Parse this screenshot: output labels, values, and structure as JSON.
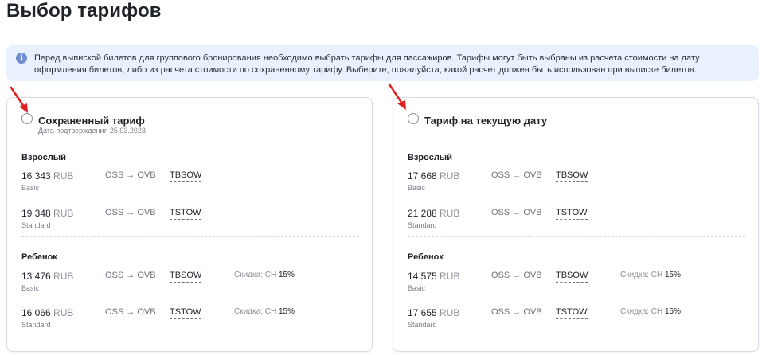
{
  "page": {
    "title": "Выбор тарифов"
  },
  "info": {
    "text": "Перед выпиской билетов для группового бронирования необходимо выбрать тарифы для пассажиров. Тарифы могут быть выбраны из расчета стоимости на дату оформления билетов, либо из расчета стоимости по сохраненному тарифу. Выберите, пожалуйста, какой расчет должен быть использован при выписке билетов.",
    "icon": "i"
  },
  "saved": {
    "title": "Сохраненный тариф",
    "subtitle": "Дата подтверждения 25.03.2023",
    "adult_label": "Взрослый",
    "child_label": "Ребенок",
    "rows": [
      {
        "amount": "16 343",
        "currency": "RUB",
        "class": "Basic",
        "route": "OSS → OVB",
        "code": "TBSOW",
        "discount_label": "",
        "discount_pct": ""
      },
      {
        "amount": "19 348",
        "currency": "RUB",
        "class": "Standard",
        "route": "OSS → OVB",
        "code": "TSTOW",
        "discount_label": "",
        "discount_pct": ""
      },
      {
        "amount": "13 476",
        "currency": "RUB",
        "class": "Basic",
        "route": "OSS → OVB",
        "code": "TBSOW",
        "discount_label": "Скидка: CH",
        "discount_pct": "15%"
      },
      {
        "amount": "16 066",
        "currency": "RUB",
        "class": "Standard",
        "route": "OSS → OVB",
        "code": "TSTOW",
        "discount_label": "Скидка: CH",
        "discount_pct": "15%"
      }
    ]
  },
  "current": {
    "title": "Тариф на текущую дату",
    "adult_label": "Взрослый",
    "child_label": "Ребенок",
    "rows": [
      {
        "amount": "17 668",
        "currency": "RUB",
        "class": "Basic",
        "route": "OSS → OVB",
        "code": "TBSOW",
        "discount_label": "",
        "discount_pct": ""
      },
      {
        "amount": "21 288",
        "currency": "RUB",
        "class": "Standard",
        "route": "OSS → OVB",
        "code": "TSTOW",
        "discount_label": "",
        "discount_pct": ""
      },
      {
        "amount": "14 575",
        "currency": "RUB",
        "class": "Basic",
        "route": "OSS → OVB",
        "code": "TBSOW",
        "discount_label": "Скидка: CH",
        "discount_pct": "15%"
      },
      {
        "amount": "17 655",
        "currency": "RUB",
        "class": "Standard",
        "route": "OSS → OVB",
        "code": "TSTOW",
        "discount_label": "Скидка: CH",
        "discount_pct": "15%"
      }
    ]
  },
  "colors": {
    "info_bg": "#e9f0fe",
    "info_icon": "#6f8dd0",
    "annotation_arrow": "#e02020"
  }
}
